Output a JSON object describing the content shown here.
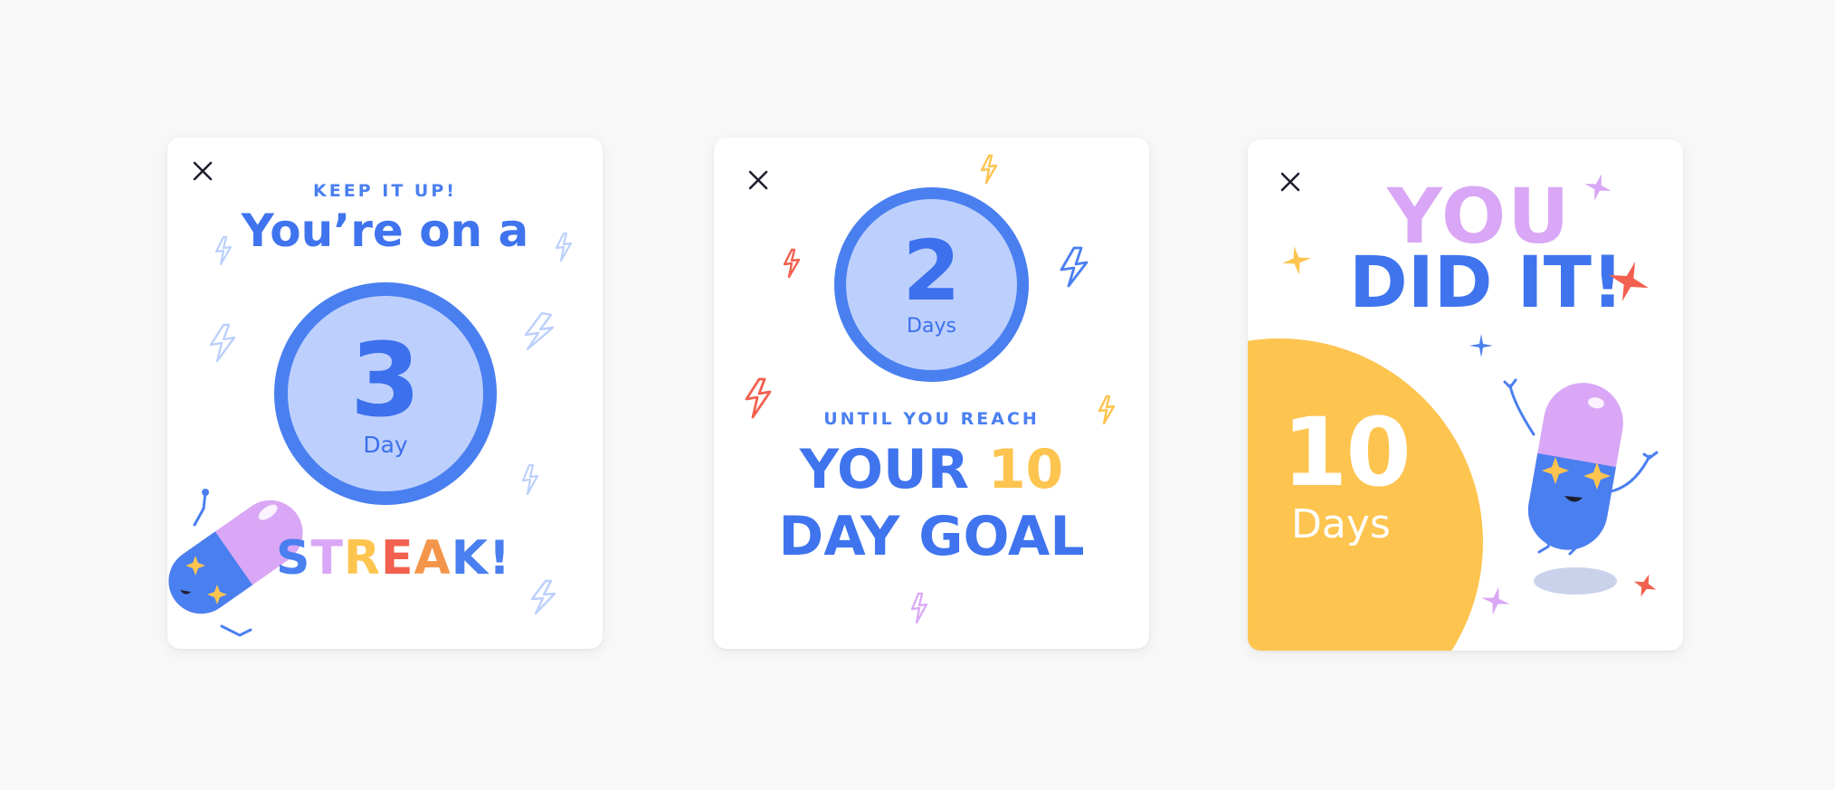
{
  "card1": {
    "kicker": "KEEP IT UP!",
    "headline": "You’re on a",
    "count": "3",
    "unit": "Day",
    "streak_letters": [
      {
        "ch": "S",
        "color": "#4a7ff0"
      },
      {
        "ch": "T",
        "color": "#d9a7f5"
      },
      {
        "ch": "R",
        "color": "#fdc44f"
      },
      {
        "ch": "E",
        "color": "#f2604f"
      },
      {
        "ch": "A",
        "color": "#f3964b"
      },
      {
        "ch": "K",
        "color": "#4a7ff0"
      },
      {
        "ch": "!",
        "color": "#4a7ff0"
      }
    ]
  },
  "card2": {
    "count": "2",
    "unit": "Days",
    "kicker": "UNTIL YOU REACH",
    "line1_a": "YOUR ",
    "line1_b": "10",
    "line2": "DAY GOAL"
  },
  "card3": {
    "you": "YOU",
    "did": "DID IT!",
    "count": "10",
    "unit": "Days"
  },
  "colors": {
    "blue": "#4a7ff0",
    "light_blue": "#bdd0fd",
    "purple": "#d9a7f5",
    "yellow": "#fdc44f",
    "red": "#f2604f"
  }
}
